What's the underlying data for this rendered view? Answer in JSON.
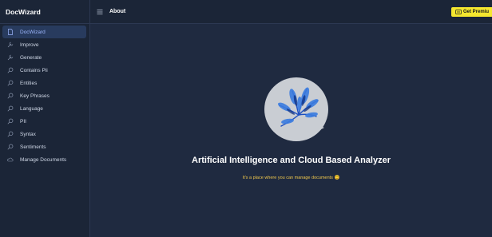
{
  "app": {
    "title": "DocWizard"
  },
  "header": {
    "title": "About",
    "premium_label": "Get Premiu"
  },
  "sidebar": {
    "items": [
      {
        "label": "DocWizard",
        "icon": "document-icon",
        "active": true
      },
      {
        "label": "Improve",
        "icon": "tools-icon",
        "active": false
      },
      {
        "label": "Generate",
        "icon": "tools-icon",
        "active": false
      },
      {
        "label": "Contains Pii",
        "icon": "search-icon",
        "active": false
      },
      {
        "label": "Entities",
        "icon": "search-icon",
        "active": false
      },
      {
        "label": "Key Phrases",
        "icon": "search-icon",
        "active": false
      },
      {
        "label": "Language",
        "icon": "search-icon",
        "active": false
      },
      {
        "label": "PII",
        "icon": "search-icon",
        "active": false
      },
      {
        "label": "Syntax",
        "icon": "search-icon",
        "active": false
      },
      {
        "label": "Sentiments",
        "icon": "search-icon",
        "active": false
      },
      {
        "label": "Manage Documents",
        "icon": "cloud-icon",
        "active": false
      }
    ]
  },
  "main": {
    "headline": "Artificial Intelligence and Cloud Based Analyzer",
    "subline": "It's a place where you can manage documents 😊"
  },
  "colors": {
    "background": "#1f2a40",
    "sidebar": "#1b2537",
    "active_item": "#283b5e",
    "premium": "#f5e72f",
    "subline": "#f2c94c"
  }
}
